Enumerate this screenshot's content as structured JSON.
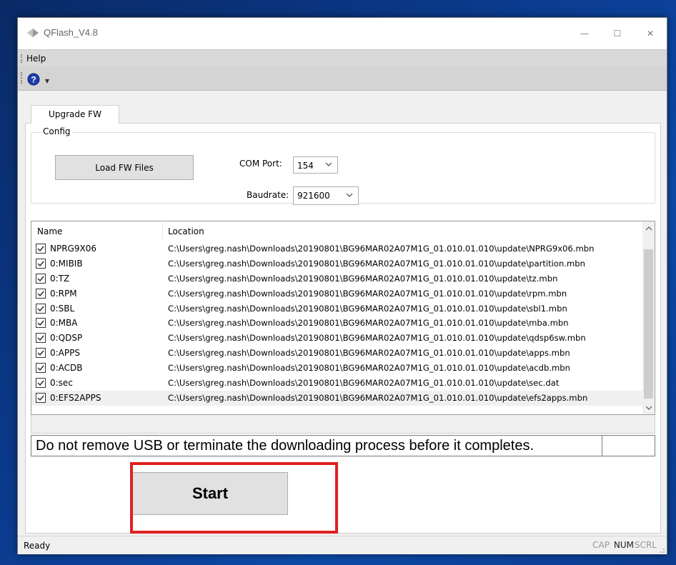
{
  "window": {
    "title": "QFlash_V4.8",
    "icon": "diamond-icon",
    "controls": {
      "minimize": "—",
      "maximize": "☐",
      "close": "✕"
    }
  },
  "menu": {
    "help": "Help"
  },
  "toolbar": {
    "help_icon": "help-question-icon",
    "dropdown": "▼"
  },
  "tab": {
    "label": "Upgrade FW"
  },
  "config": {
    "group_label": "Config",
    "load_button": "Load FW Files",
    "com_port_label": "COM Port:",
    "com_port_value": "154",
    "baudrate_label": "Baudrate:",
    "baudrate_value": "921600"
  },
  "file_list": {
    "headers": {
      "name": "Name",
      "location": "Location"
    },
    "rows": [
      {
        "name": "NPRG9X06",
        "location": "C:\\Users\\greg.nash\\Downloads\\20190801\\BG96MAR02A07M1G_01.010.01.010\\update\\NPRG9x06.mbn",
        "checked": true
      },
      {
        "name": "0:MIBIB",
        "location": "C:\\Users\\greg.nash\\Downloads\\20190801\\BG96MAR02A07M1G_01.010.01.010\\update\\partition.mbn",
        "checked": true
      },
      {
        "name": "0:TZ",
        "location": "C:\\Users\\greg.nash\\Downloads\\20190801\\BG96MAR02A07M1G_01.010.01.010\\update\\tz.mbn",
        "checked": true
      },
      {
        "name": "0:RPM",
        "location": "C:\\Users\\greg.nash\\Downloads\\20190801\\BG96MAR02A07M1G_01.010.01.010\\update\\rpm.mbn",
        "checked": true
      },
      {
        "name": "0:SBL",
        "location": "C:\\Users\\greg.nash\\Downloads\\20190801\\BG96MAR02A07M1G_01.010.01.010\\update\\sbl1.mbn",
        "checked": true
      },
      {
        "name": "0:MBA",
        "location": "C:\\Users\\greg.nash\\Downloads\\20190801\\BG96MAR02A07M1G_01.010.01.010\\update\\mba.mbn",
        "checked": true
      },
      {
        "name": "0:QDSP",
        "location": "C:\\Users\\greg.nash\\Downloads\\20190801\\BG96MAR02A07M1G_01.010.01.010\\update\\qdsp6sw.mbn",
        "checked": true
      },
      {
        "name": "0:APPS",
        "location": "C:\\Users\\greg.nash\\Downloads\\20190801\\BG96MAR02A07M1G_01.010.01.010\\update\\apps.mbn",
        "checked": true
      },
      {
        "name": "0:ACDB",
        "location": "C:\\Users\\greg.nash\\Downloads\\20190801\\BG96MAR02A07M1G_01.010.01.010\\update\\acdb.mbn",
        "checked": true
      },
      {
        "name": "0:sec",
        "location": "C:\\Users\\greg.nash\\Downloads\\20190801\\BG96MAR02A07M1G_01.010.01.010\\update\\sec.dat",
        "checked": true
      },
      {
        "name": "0:EFS2APPS",
        "location": "C:\\Users\\greg.nash\\Downloads\\20190801\\BG96MAR02A07M1G_01.010.01.010\\update\\efs2apps.mbn",
        "checked": true
      }
    ]
  },
  "warning": "Do not remove USB or terminate the downloading process before it completes.",
  "start_button": "Start",
  "status": {
    "text": "Ready",
    "indicators": {
      "cap": "CAP",
      "num": "NUM",
      "scrl": "SCRL"
    }
  },
  "colors": {
    "highlight": "#e02020",
    "desktop": "#0b3a8c"
  }
}
